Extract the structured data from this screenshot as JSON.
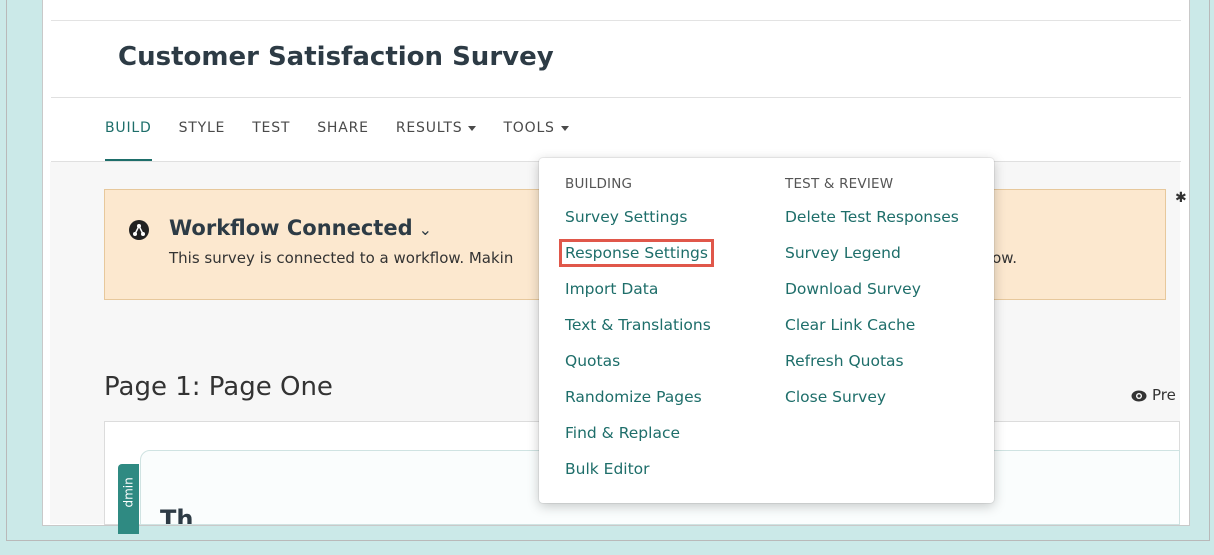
{
  "survey": {
    "title": "Customer Satisfaction Survey"
  },
  "nav": {
    "tabs": [
      {
        "label": "BUILD"
      },
      {
        "label": "STYLE"
      },
      {
        "label": "TEST"
      },
      {
        "label": "SHARE"
      },
      {
        "label": "RESULTS"
      },
      {
        "label": "TOOLS"
      }
    ]
  },
  "alert": {
    "title": "Workflow Connected",
    "text": "This survey is connected to a workflow. Makin",
    "text_tail": "kflow."
  },
  "page": {
    "heading": "Page 1: Page One",
    "preview_label": "Pre",
    "admin_label": "dmin",
    "question_heading_partial": "Th"
  },
  "tools_menu": {
    "building_header": "BUILDING",
    "building_items": [
      {
        "label": "Survey Settings"
      },
      {
        "label": "Response Settings"
      },
      {
        "label": "Import Data"
      },
      {
        "label": "Text & Translations"
      },
      {
        "label": "Quotas"
      },
      {
        "label": "Randomize Pages"
      },
      {
        "label": "Find & Replace"
      },
      {
        "label": "Bulk Editor"
      }
    ],
    "review_header": "TEST & REVIEW",
    "review_items": [
      {
        "label": "Delete Test Responses"
      },
      {
        "label": "Survey Legend"
      },
      {
        "label": "Download Survey"
      },
      {
        "label": "Clear Link Cache"
      },
      {
        "label": "Refresh Quotas"
      },
      {
        "label": "Close Survey"
      }
    ]
  },
  "colors": {
    "accent": "#1e6e6a",
    "alert_bg": "#fce8cf",
    "highlight": "#e0574a",
    "background": "#cbe9e8"
  }
}
